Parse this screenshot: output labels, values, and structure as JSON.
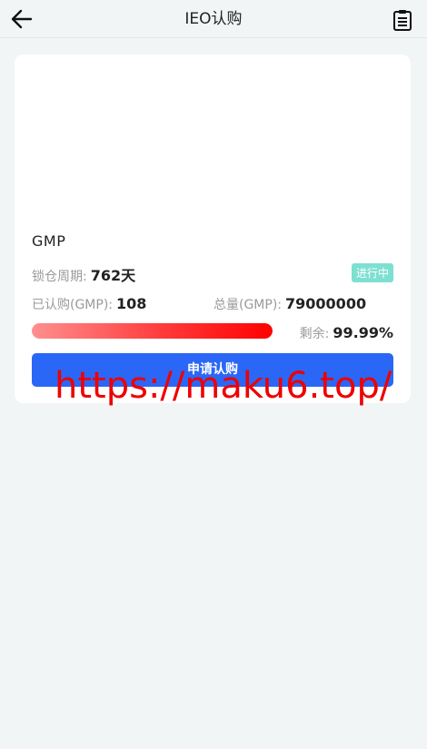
{
  "header": {
    "title": "IEO认购",
    "back_icon": "arrow-left-icon",
    "record_icon": "clipboard-list-icon"
  },
  "card": {
    "coin_name": "GMP",
    "status": "进行中",
    "status_color": "#7de0d0",
    "lock_label": "锁仓周期:",
    "lock_value": "762天",
    "subscribed_label": "已认购(GMP):",
    "subscribed_value": "108",
    "total_label": "总量(GMP):",
    "total_value": "79000000",
    "remaining_label": "剩余:",
    "remaining_value": "99.99%",
    "progress_fraction": 1.0,
    "apply_label": "申请认购"
  },
  "watermark": "https://maku6.top/",
  "colors": {
    "accent": "#2b67f6",
    "progress": "#ff0000",
    "background": "#f2f5f6"
  }
}
